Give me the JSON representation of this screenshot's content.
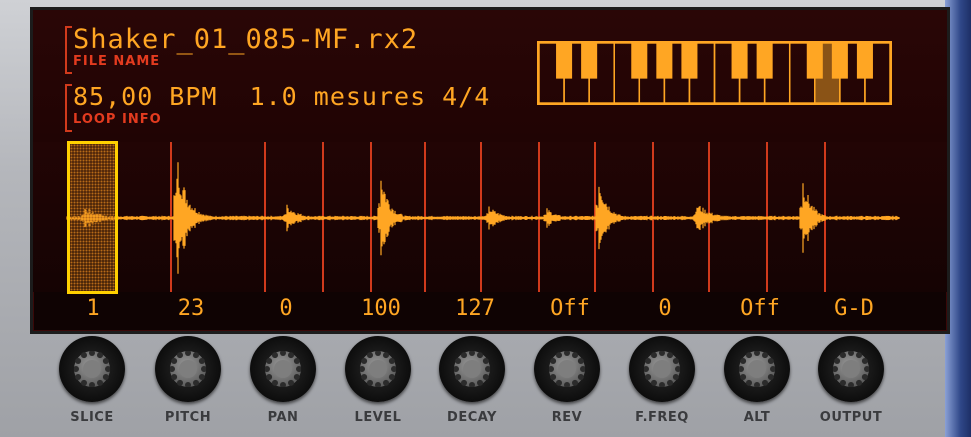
{
  "device": {
    "file_name": "Shaker_01_085-MF.rx2",
    "file_name_label": "FILE NAME",
    "loop_info": "85,00 BPM  1.0 mesures 4/4",
    "loop_info_label": "LOOP INFO"
  },
  "colors": {
    "display_amber": "#ffa623",
    "display_red": "#d13a1c",
    "selection_yellow": "#ffd000"
  },
  "slice_values": [
    "1",
    "23",
    "0",
    "100",
    "127",
    "Off",
    "0",
    "Off",
    "G-D"
  ],
  "knobs": [
    {
      "label": "SLICE"
    },
    {
      "label": "PITCH"
    },
    {
      "label": "PAN"
    },
    {
      "label": "LEVEL"
    },
    {
      "label": "DECAY"
    },
    {
      "label": "REV"
    },
    {
      "label": "F.FREQ"
    },
    {
      "label": "ALT"
    },
    {
      "label": "OUTPUT"
    }
  ],
  "keyboard": {
    "white_key_count": 14,
    "highlighted_key": "G"
  },
  "slices": {
    "count": 14,
    "selected_index": 1
  }
}
